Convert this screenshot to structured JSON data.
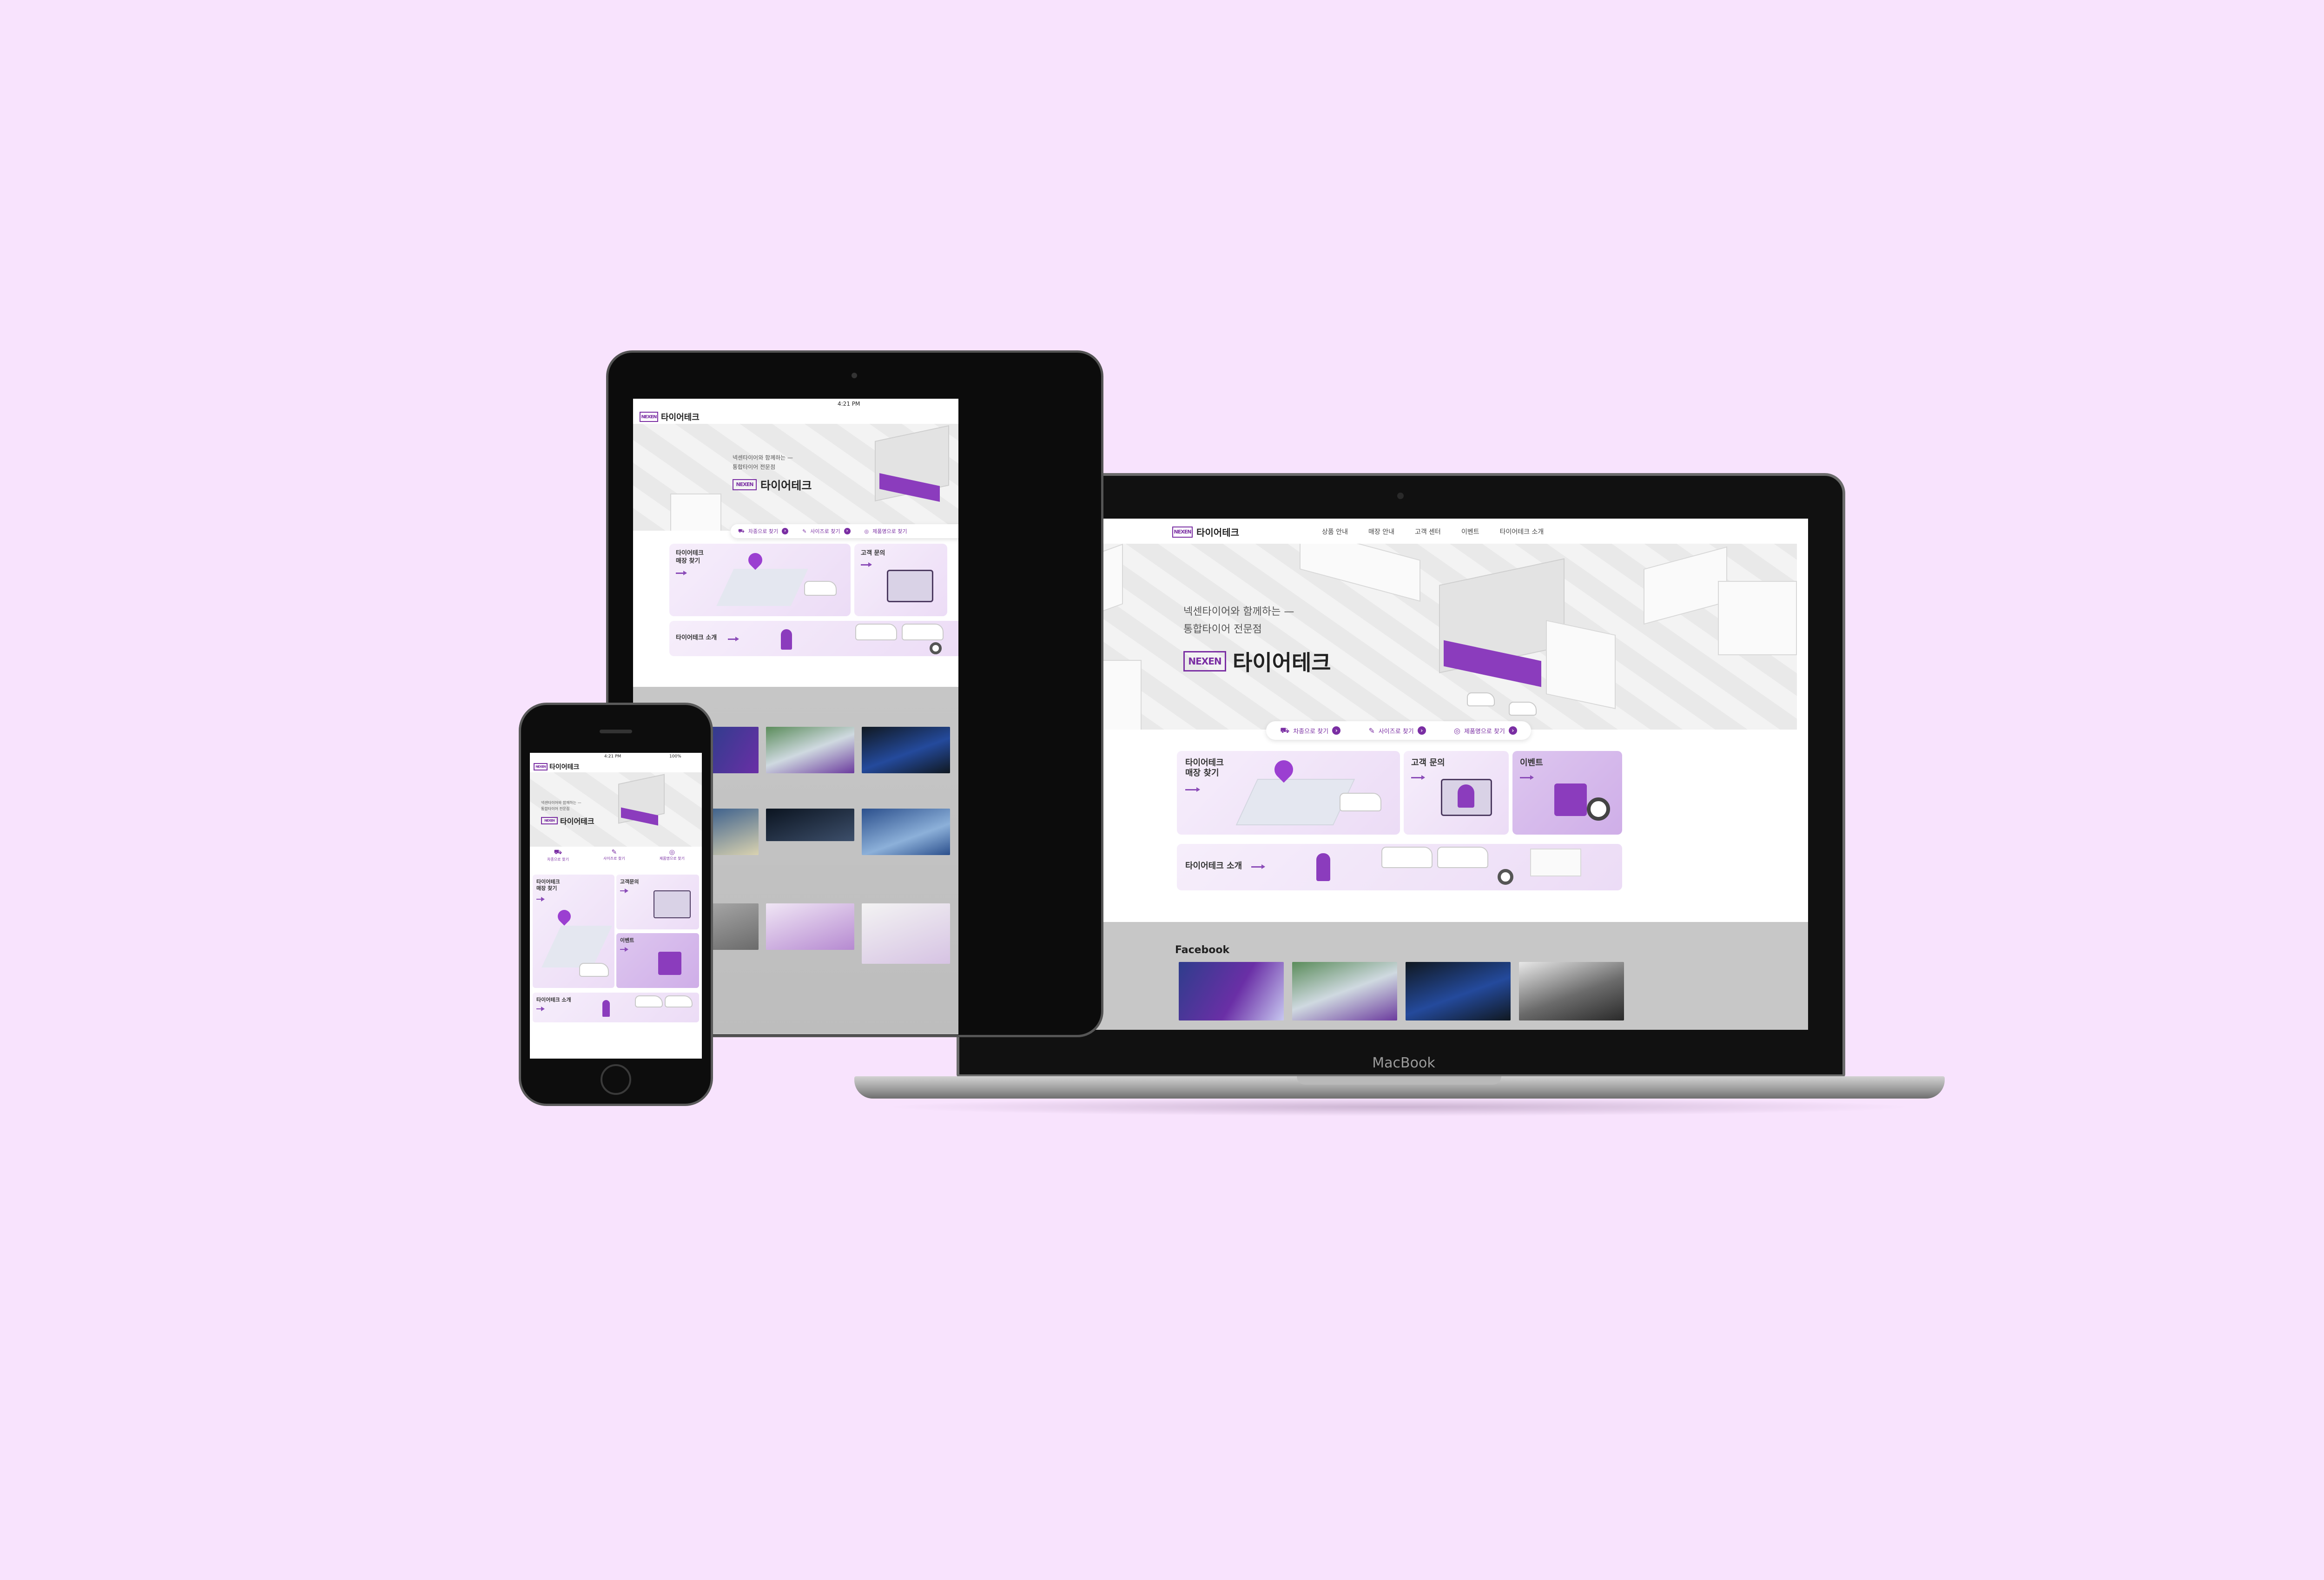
{
  "brand": {
    "title": "타이어테크",
    "logo_text": "NEXEN",
    "accent": "#7a2ea3",
    "accent_light": "#ecdcf6"
  },
  "nav": {
    "items": [
      "상품 안내",
      "매장 안내",
      "고객 센터",
      "이벤트",
      "타이어테크 소개"
    ]
  },
  "hero": {
    "line1": "넥센타이어와 함께하는 —",
    "line2": "통합타이어 전문점",
    "title": "타이어테크"
  },
  "quick_search": {
    "items": [
      {
        "label": "차종으로 찾기",
        "icon": "car-icon"
      },
      {
        "label": "사이즈로 찾기",
        "icon": "ruler-icon"
      },
      {
        "label": "제품명으로 찾기",
        "icon": "tire-icon"
      }
    ],
    "go": "›"
  },
  "tiles": {
    "store_find": "타이어테크\n매장 찾기",
    "store_find_l1": "타이어테크",
    "store_find_l2": "매장 찾기",
    "inquiry": "고객 문의",
    "inquiry_phone": "고객문의",
    "event": "이벤트",
    "about": "타이어테크 소개"
  },
  "facebook": {
    "heading": "Facebook"
  },
  "status_bar": {
    "time": "4:21 PM",
    "battery": "100%"
  },
  "device": {
    "laptop_label": "MacBook"
  }
}
